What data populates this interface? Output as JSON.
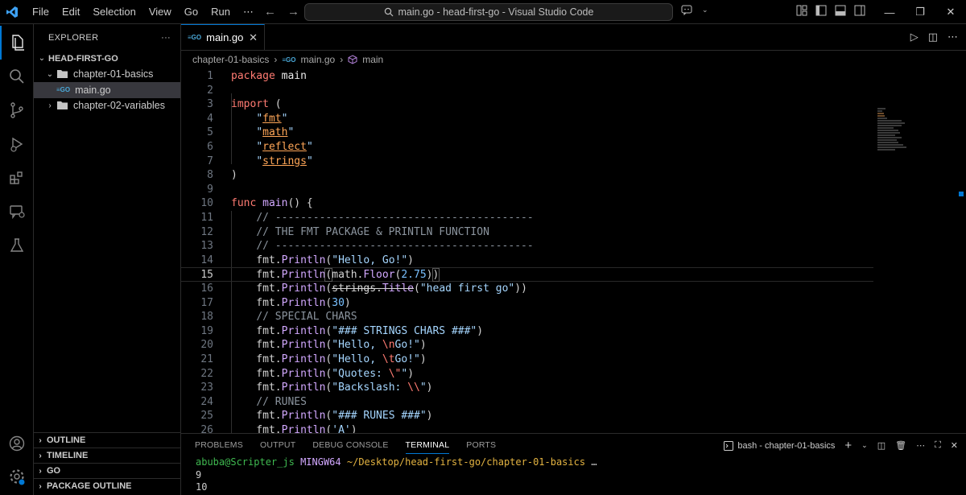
{
  "menu": [
    "File",
    "Edit",
    "Selection",
    "View",
    "Go",
    "Run",
    "⋯"
  ],
  "window_title": "main.go - head-first-go - Visual Studio Code",
  "explorer": {
    "title": "EXPLORER",
    "more": "···",
    "root": "HEAD-FIRST-GO",
    "items": [
      {
        "label": "chapter-01-basics",
        "type": "folder-open"
      },
      {
        "label": "main.go",
        "type": "file"
      },
      {
        "label": "chapter-02-variables",
        "type": "folder"
      }
    ]
  },
  "sidebar_sections": [
    "OUTLINE",
    "TIMELINE",
    "GO",
    "PACKAGE OUTLINE"
  ],
  "tab": {
    "icon_text": "GO",
    "label": "main.go",
    "close": "✕"
  },
  "breadcrumb": {
    "folder": "chapter-01-basics",
    "file": "main.go",
    "symbol": "main"
  },
  "code": {
    "current_line": 15,
    "lines": [
      {
        "n": "1"
      },
      {
        "n": "2"
      },
      {
        "n": "3"
      },
      {
        "n": "4"
      },
      {
        "n": "5"
      },
      {
        "n": "6"
      },
      {
        "n": "7"
      },
      {
        "n": "8"
      },
      {
        "n": "9"
      },
      {
        "n": "10"
      },
      {
        "n": "11"
      },
      {
        "n": "12"
      },
      {
        "n": "13"
      },
      {
        "n": "14"
      },
      {
        "n": "15"
      },
      {
        "n": "16"
      },
      {
        "n": "17"
      },
      {
        "n": "18"
      },
      {
        "n": "19"
      },
      {
        "n": "20"
      },
      {
        "n": "21"
      },
      {
        "n": "22"
      },
      {
        "n": "23"
      },
      {
        "n": "24"
      },
      {
        "n": "25"
      },
      {
        "n": "26"
      }
    ],
    "package_kw": "package",
    "package_name": "main",
    "import_kw": "import",
    "imports": [
      "fmt",
      "math",
      "reflect",
      "strings"
    ],
    "func_kw": "func",
    "func_name": "main",
    "comment_rule": "// -----------------------------------------",
    "comment_fmt": "// THE FMT PACKAGE & PRINTLN FUNCTION",
    "comment_special": "// SPECIAL CHARS",
    "comment_runes": "// RUNES",
    "hello": "\"Hello, Go!\"",
    "floor_arg": "2.75",
    "title_arg": "\"head first go\"",
    "num30": "30",
    "strings_chars": "\"### STRINGS CHARS ###\"",
    "hello_n_a": "\"Hello, ",
    "hello_n_esc": "\\n",
    "hello_n_b": "Go!\"",
    "hello_t_a": "\"Hello, ",
    "hello_t_esc": "\\t",
    "hello_t_b": "Go!\"",
    "quotes_a": "\"Quotes: ",
    "quotes_esc": "\\\"",
    "quotes_mid": "\\\"",
    "quotes_b": "\"",
    "backslash_a": "\"Backslash: ",
    "backslash_esc": "\\\\",
    "backslash_b": "\"",
    "runes_header": "\"### RUNES ###\"",
    "rune_a": "'A'"
  },
  "panel": {
    "tabs": [
      "PROBLEMS",
      "OUTPUT",
      "DEBUG CONSOLE",
      "TERMINAL",
      "PORTS"
    ],
    "active_tab": "TERMINAL",
    "terminal_name": "bash - chapter-01-basics",
    "prompt_user": "abuba@Scripter_js",
    "prompt_host": "MINGW64",
    "prompt_path": "~/Desktop/head-first-go/chapter-01-basics",
    "prompt_tail": "…",
    "output": [
      "9",
      "10"
    ]
  },
  "colors": {
    "accent": "#0078d4",
    "background": "#000000"
  }
}
